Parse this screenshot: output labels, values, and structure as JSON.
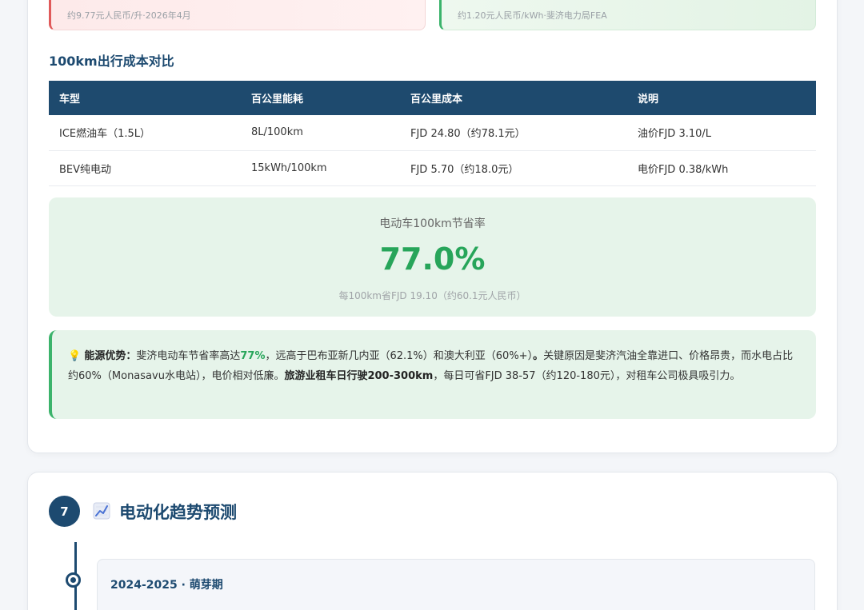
{
  "price_cards": {
    "fuel_note": "约9.77元人民币/升·2026年4月",
    "elec_note": "约1.20元人民币/kWh·斐济电力局FEA"
  },
  "cost_section": {
    "title": "100km出行成本对比",
    "headers": [
      "车型",
      "百公里能耗",
      "百公里成本",
      "说明"
    ],
    "rows": [
      [
        "ICE燃油车（1.5L）",
        "8L/100km",
        "FJD 24.80（约78.1元）",
        "油价FJD 3.10/L"
      ],
      [
        "BEV纯电动",
        "15kWh/100km",
        "FJD 5.70（约18.0元）",
        "电价FJD 0.38/kWh"
      ]
    ]
  },
  "saving": {
    "label": "电动车100km节省率",
    "rate": "77.0%",
    "sub": "每100km省FJD 19.10（约60.1元人民币）"
  },
  "tip": {
    "icon": "lightbulb-icon",
    "lead": "能源优势：",
    "t1": "斐济电动车节省率高达",
    "highlight": "77%",
    "t2": "，远高于巴布亚新几内亚（62.1%）和澳大利亚（60%+）",
    "period": "。",
    "t3": "关键原因是斐济汽油全靠进口、价格昂贵，而水电占比约60%（Monasavu水电站），电价相对低廉。",
    "bold2": "旅游业租车日行驶200-300km",
    "t4": "，每日可省FJD 38-57（约120-180元），对租车公司极具吸引力。"
  },
  "section7": {
    "number": "7",
    "icon": "trend-chart-icon",
    "title": "电动化趋势预测",
    "phases": [
      {
        "title": "2024-2025 · 萌芽期"
      }
    ]
  },
  "colors": {
    "navy": "#1d4a70",
    "green": "#27a55a",
    "red_accent": "#e05a5a"
  }
}
